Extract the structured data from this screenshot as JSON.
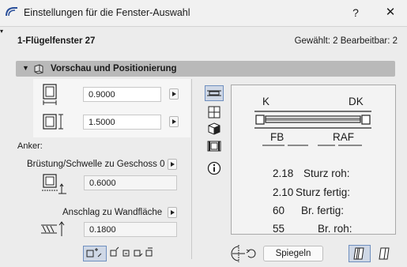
{
  "window": {
    "title": "Einstellungen für die Fenster-Auswahl",
    "help": "?",
    "close": "✕"
  },
  "header": {
    "element_name": "1-Flügelfenster 27",
    "selection_info": "Gewählt: 2 Bearbeitbar: 2"
  },
  "panel": {
    "title": "Vorschau und Positionierung"
  },
  "dimensions": {
    "width_value": "0.9000",
    "height_value": "1.5000"
  },
  "anchor": {
    "label": "Anker:",
    "sill_label": "Brüstung/Schwelle zu Geschoss 0",
    "sill_value": "0.6000",
    "reveal_label": "Anschlag zu Wandfläche",
    "reveal_value": "0.1800"
  },
  "preview": {
    "label_k": "K",
    "label_dk": "DK",
    "label_fb": "FB",
    "label_raf": "RAF",
    "stats": [
      {
        "value": "2.18",
        "label": "Sturz roh:"
      },
      {
        "value": "2.10",
        "label": "Sturz fertig:"
      },
      {
        "value": "60",
        "label": "Br. fertig:"
      },
      {
        "value": "55",
        "label": "Br. roh:"
      }
    ]
  },
  "buttons": {
    "mirror": "Spiegeln"
  },
  "icons": {
    "app": "archicad-icon",
    "panel": "window-3d-icon",
    "view_tabs": [
      "plan-view-icon",
      "elevation-grid-icon",
      "cube-3d-icon",
      "section-view-icon",
      "info-icon"
    ]
  },
  "colors": {
    "accent_selected": "#cfd8e6",
    "panel_header": "#b9b9b9"
  }
}
